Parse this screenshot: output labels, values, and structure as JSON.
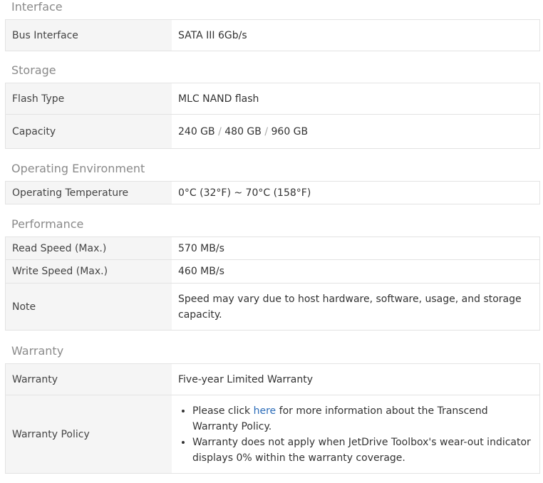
{
  "sections": [
    {
      "title": "Interface",
      "rows": [
        {
          "label": "Bus Interface",
          "value": "SATA III 6Gb/s"
        }
      ]
    },
    {
      "title": "Storage",
      "rows": [
        {
          "label": "Flash Type",
          "value": "MLC NAND flash"
        },
        {
          "label": "Capacity",
          "values": [
            "240 GB",
            "480 GB",
            "960 GB"
          ],
          "separator": " / "
        }
      ]
    },
    {
      "title": "Operating Environment",
      "rows": [
        {
          "label": "Operating Temperature",
          "value": "0°C (32°F) ~ 70°C (158°F)"
        }
      ]
    },
    {
      "title": "Performance",
      "rows": [
        {
          "label": "Read Speed (Max.)",
          "value": "570 MB/s"
        },
        {
          "label": "Write Speed (Max.)",
          "value": "460 MB/s"
        },
        {
          "label": "Note",
          "value": "Speed may vary due to host hardware, software, usage, and storage capacity."
        }
      ]
    },
    {
      "title": "Warranty",
      "rows": [
        {
          "label": "Warranty",
          "value": "Five-year Limited Warranty"
        },
        {
          "label": "Warranty Policy",
          "bullets": [
            {
              "before": "Please click ",
              "link": "here",
              "after": " for more information about the Transcend Warranty Policy."
            },
            {
              "text": "Warranty does not apply when JetDrive Toolbox's wear-out indicator displays 0% within the warranty coverage."
            }
          ]
        }
      ]
    }
  ]
}
